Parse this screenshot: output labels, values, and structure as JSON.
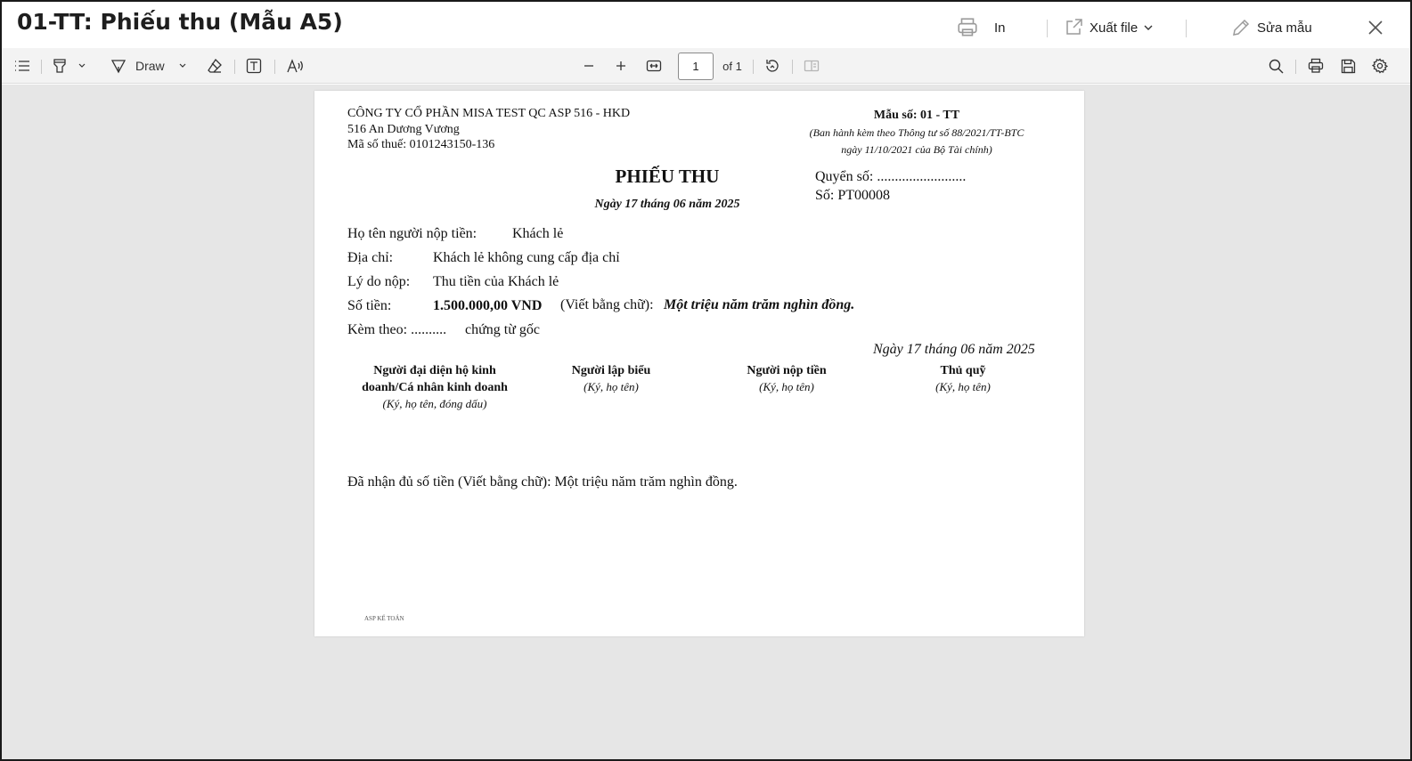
{
  "window": {
    "title": "01-TT: Phiếu thu (Mẫu A5)",
    "print_label": "In",
    "export_label": "Xuất file",
    "edit_label": "Sửa mẫu"
  },
  "toolbar": {
    "draw_label": "Draw",
    "page_number": "1",
    "page_of": "of 1"
  },
  "document": {
    "company_name": "CÔNG TY CỔ PHẦN MISA TEST QC ASP 516 - HKD",
    "company_address": "516 An Dương Vương",
    "tax_code": "Mã số thuế: 0101243150-136",
    "form_no": "Mẫu số: 01 - TT",
    "form_note_1": "(Ban hành kèm theo Thông tư số 88/2021/TT-BTC",
    "form_note_2": "ngày 11/10/2021 của Bộ Tài chính)",
    "heading": "PHIẾU THU",
    "date": "Ngày 17 tháng 06 năm 2025",
    "book_no": "Quyển số: .........................",
    "voucher_no": "Số: PT00008",
    "payer_label": "Họ tên người nộp tiền:",
    "payer_value": "Khách lẻ",
    "address_label": "Địa chỉ:",
    "address_value": "Khách lẻ không cung cấp địa chỉ",
    "reason_label": "Lý do nộp:",
    "reason_value": "Thu tiền của Khách lẻ",
    "amount_label": "Số tiền:",
    "amount_value": "1.500.000,00 VND",
    "amount_words_label": "(Viết bằng chữ):",
    "amount_words_value": "Một triệu năm trăm nghìn đồng.",
    "attach_label": "Kèm theo: ..........",
    "attach_value": "chứng từ gốc",
    "sign_date": "Ngày 17 tháng 06 năm 2025",
    "signatures": [
      {
        "title_1": "Người đại diện hộ kinh",
        "title_2": "doanh/Cá nhân kinh doanh",
        "sub": "(Ký, họ tên, đóng dấu)"
      },
      {
        "title_1": "Người lập biểu",
        "title_2": "",
        "sub": "(Ký, họ tên)"
      },
      {
        "title_1": "Người nộp tiền",
        "title_2": "",
        "sub": "(Ký, họ tên)"
      },
      {
        "title_1": "Thủ quỹ",
        "title_2": "",
        "sub": "(Ký, họ tên)"
      }
    ],
    "received_note": "Đã nhận đủ số tiền (Viết bằng chữ): Một triệu năm trăm nghìn đồng.",
    "footer_brand": "ASP KẾ TOÁN"
  }
}
